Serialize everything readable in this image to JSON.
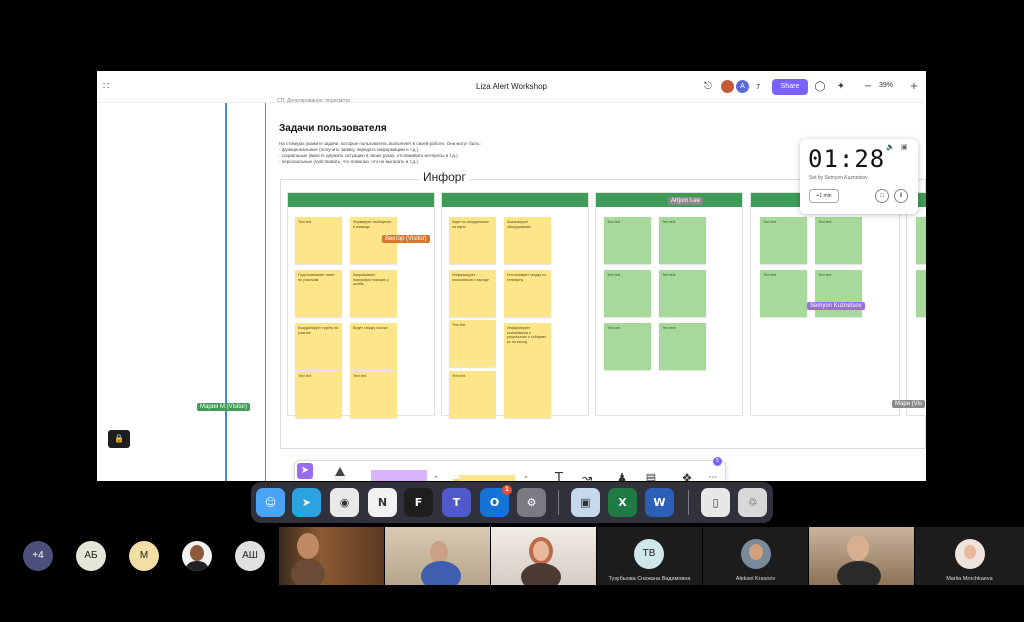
{
  "app": {
    "title": "Liza Alert Workshop",
    "logo": "∷",
    "user_count": "7",
    "share_label": "Share",
    "zoom": "39%"
  },
  "canvas": {
    "breadcrumb": "СП: Делегирование: пересмотр",
    "heading": "Задачи пользователя",
    "desc": [
      "На стикерах укажите задачи, которые пользователь выполняет в своей работе. Они могут быть:",
      "- функциональные (получить заявку, передать информацию и т.д.)",
      "- социальные (вместе держать ситуацию в своих руках, отслеживать интересы и т.д.)",
      "- персональные (чувствовать, что помогаю, что не выгорать и т.д.)"
    ],
    "board_title": "Инфорг"
  },
  "stickies": {
    "c1": [
      "Text text",
      "Формирует пообщение в команде",
      "Подготавливает пакет по участкам",
      "Запрашивает поисковую позицию у штаба",
      "Координирует группу на участке",
      "Ведёт сводку поиска",
      "Text text",
      "Text text"
    ],
    "c2": [
      "Ищет по координатам на карте",
      "Анализирует оборудование",
      "Информирует поисковиков о выходе",
      "Отслеживает сводку по телефону",
      "Text text",
      "Информирует поисковиков о результатах и собирает их на выход",
      "Text text"
    ],
    "c3": [
      "Text text",
      "Text text",
      "Text text",
      "Text text",
      "Text text",
      "Text text"
    ],
    "c4": [
      "Text text",
      "Text text",
      "Text text",
      "Text text"
    ]
  },
  "cursors": [
    {
      "label": "Artjom Lee",
      "color": "#8a8a8a"
    },
    {
      "label": "Вектор (Visitor)",
      "color": "#d8762f"
    },
    {
      "label": "Semyon Kuznetsov",
      "color": "#9a6af0"
    },
    {
      "label": "Мария М (Visitor)",
      "color": "#3e9b58"
    },
    {
      "label": "Мари (Vis",
      "color": "#8a8a8a"
    }
  ],
  "timer": {
    "time": "01:28",
    "set_by": "Set by Semyon Kuznetsov",
    "add_label": "+1 min"
  },
  "toolbar": {
    "badge": "5"
  },
  "help": "?",
  "dock": {
    "apps": [
      {
        "name": "Finder",
        "glyph": "☺",
        "color": "#4aa3f5"
      },
      {
        "name": "Telegram",
        "glyph": "➤",
        "color": "#2aa3e0"
      },
      {
        "name": "Chrome",
        "glyph": "◉",
        "color": "#e9e9e9"
      },
      {
        "name": "Notion",
        "glyph": "N",
        "color": "#f2f2f2"
      },
      {
        "name": "Figma",
        "glyph": "F",
        "color": "#1e1e1e"
      },
      {
        "name": "Teams",
        "glyph": "T",
        "color": "#5059c9"
      },
      {
        "name": "Outlook",
        "glyph": "O",
        "color": "#1473d4"
      },
      {
        "name": "Settings",
        "glyph": "⚙",
        "color": "#7a7a82"
      },
      {
        "name": "Preview",
        "glyph": "▣",
        "color": "#c6d8ec"
      },
      {
        "name": "Excel",
        "glyph": "X",
        "color": "#1f7a43"
      },
      {
        "name": "Word",
        "glyph": "W",
        "color": "#2b5fb8"
      },
      {
        "name": "Documents",
        "glyph": "▯",
        "color": "#e7e7e7"
      },
      {
        "name": "Trash",
        "glyph": "♲",
        "color": "#d8d8d8"
      }
    ],
    "outlook_badge": "1"
  },
  "participants": {
    "more": "+4",
    "initials": [
      {
        "text": "АБ",
        "color": "#e2e7d8"
      },
      {
        "text": "М",
        "color": "#f3dfa4"
      },
      {
        "text": "АШ",
        "color": "#e0e0e0"
      }
    ],
    "names": [
      "Тузубыова Снежана Вадимовна",
      "Aleksei Krasnov",
      "Mariia Mrochkaeva"
    ],
    "tv_initials": "ТВ"
  }
}
